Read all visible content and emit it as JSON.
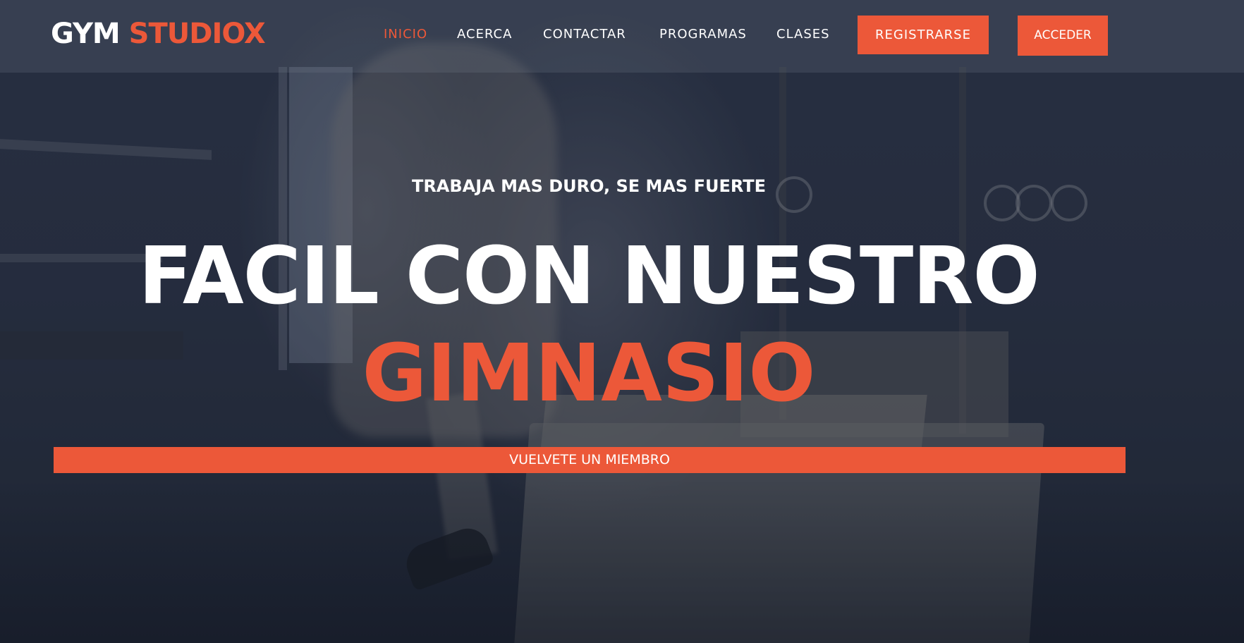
{
  "brand": {
    "logo_part1": "GYM",
    "logo_part2": "STUDIOX",
    "accent_color": "#ec5839"
  },
  "nav": {
    "items": [
      {
        "label": "INICIO",
        "active": true
      },
      {
        "label": "ACERCA",
        "active": false
      },
      {
        "label": "CONTACTAR",
        "active": false
      },
      {
        "label": "PROGRAMAS",
        "active": false
      },
      {
        "label": "CLASES",
        "active": false
      }
    ],
    "register_label": "REGISTRARSE",
    "login_label": "ACCEDER"
  },
  "hero": {
    "tagline": "TRABAJA MAS DURO, SE MAS FUERTE",
    "headline": "FACIL CON NUESTRO",
    "headline_accent": "GIMNASIO",
    "cta_label": "VUELVETE UN MIEMBRO"
  }
}
